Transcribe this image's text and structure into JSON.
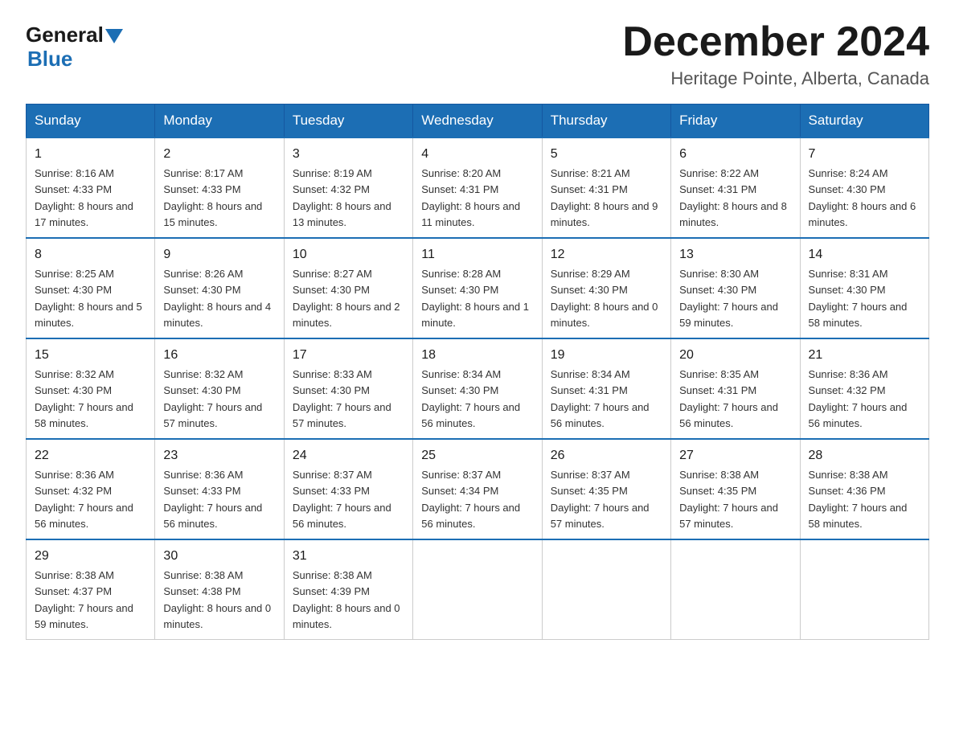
{
  "logo": {
    "general": "General",
    "blue": "Blue"
  },
  "title": "December 2024",
  "subtitle": "Heritage Pointe, Alberta, Canada",
  "days_of_week": [
    "Sunday",
    "Monday",
    "Tuesday",
    "Wednesday",
    "Thursday",
    "Friday",
    "Saturday"
  ],
  "weeks": [
    [
      {
        "num": "1",
        "sunrise": "8:16 AM",
        "sunset": "4:33 PM",
        "daylight": "8 hours and 17 minutes."
      },
      {
        "num": "2",
        "sunrise": "8:17 AM",
        "sunset": "4:33 PM",
        "daylight": "8 hours and 15 minutes."
      },
      {
        "num": "3",
        "sunrise": "8:19 AM",
        "sunset": "4:32 PM",
        "daylight": "8 hours and 13 minutes."
      },
      {
        "num": "4",
        "sunrise": "8:20 AM",
        "sunset": "4:31 PM",
        "daylight": "8 hours and 11 minutes."
      },
      {
        "num": "5",
        "sunrise": "8:21 AM",
        "sunset": "4:31 PM",
        "daylight": "8 hours and 9 minutes."
      },
      {
        "num": "6",
        "sunrise": "8:22 AM",
        "sunset": "4:31 PM",
        "daylight": "8 hours and 8 minutes."
      },
      {
        "num": "7",
        "sunrise": "8:24 AM",
        "sunset": "4:30 PM",
        "daylight": "8 hours and 6 minutes."
      }
    ],
    [
      {
        "num": "8",
        "sunrise": "8:25 AM",
        "sunset": "4:30 PM",
        "daylight": "8 hours and 5 minutes."
      },
      {
        "num": "9",
        "sunrise": "8:26 AM",
        "sunset": "4:30 PM",
        "daylight": "8 hours and 4 minutes."
      },
      {
        "num": "10",
        "sunrise": "8:27 AM",
        "sunset": "4:30 PM",
        "daylight": "8 hours and 2 minutes."
      },
      {
        "num": "11",
        "sunrise": "8:28 AM",
        "sunset": "4:30 PM",
        "daylight": "8 hours and 1 minute."
      },
      {
        "num": "12",
        "sunrise": "8:29 AM",
        "sunset": "4:30 PM",
        "daylight": "8 hours and 0 minutes."
      },
      {
        "num": "13",
        "sunrise": "8:30 AM",
        "sunset": "4:30 PM",
        "daylight": "7 hours and 59 minutes."
      },
      {
        "num": "14",
        "sunrise": "8:31 AM",
        "sunset": "4:30 PM",
        "daylight": "7 hours and 58 minutes."
      }
    ],
    [
      {
        "num": "15",
        "sunrise": "8:32 AM",
        "sunset": "4:30 PM",
        "daylight": "7 hours and 58 minutes."
      },
      {
        "num": "16",
        "sunrise": "8:32 AM",
        "sunset": "4:30 PM",
        "daylight": "7 hours and 57 minutes."
      },
      {
        "num": "17",
        "sunrise": "8:33 AM",
        "sunset": "4:30 PM",
        "daylight": "7 hours and 57 minutes."
      },
      {
        "num": "18",
        "sunrise": "8:34 AM",
        "sunset": "4:30 PM",
        "daylight": "7 hours and 56 minutes."
      },
      {
        "num": "19",
        "sunrise": "8:34 AM",
        "sunset": "4:31 PM",
        "daylight": "7 hours and 56 minutes."
      },
      {
        "num": "20",
        "sunrise": "8:35 AM",
        "sunset": "4:31 PM",
        "daylight": "7 hours and 56 minutes."
      },
      {
        "num": "21",
        "sunrise": "8:36 AM",
        "sunset": "4:32 PM",
        "daylight": "7 hours and 56 minutes."
      }
    ],
    [
      {
        "num": "22",
        "sunrise": "8:36 AM",
        "sunset": "4:32 PM",
        "daylight": "7 hours and 56 minutes."
      },
      {
        "num": "23",
        "sunrise": "8:36 AM",
        "sunset": "4:33 PM",
        "daylight": "7 hours and 56 minutes."
      },
      {
        "num": "24",
        "sunrise": "8:37 AM",
        "sunset": "4:33 PM",
        "daylight": "7 hours and 56 minutes."
      },
      {
        "num": "25",
        "sunrise": "8:37 AM",
        "sunset": "4:34 PM",
        "daylight": "7 hours and 56 minutes."
      },
      {
        "num": "26",
        "sunrise": "8:37 AM",
        "sunset": "4:35 PM",
        "daylight": "7 hours and 57 minutes."
      },
      {
        "num": "27",
        "sunrise": "8:38 AM",
        "sunset": "4:35 PM",
        "daylight": "7 hours and 57 minutes."
      },
      {
        "num": "28",
        "sunrise": "8:38 AM",
        "sunset": "4:36 PM",
        "daylight": "7 hours and 58 minutes."
      }
    ],
    [
      {
        "num": "29",
        "sunrise": "8:38 AM",
        "sunset": "4:37 PM",
        "daylight": "7 hours and 59 minutes."
      },
      {
        "num": "30",
        "sunrise": "8:38 AM",
        "sunset": "4:38 PM",
        "daylight": "8 hours and 0 minutes."
      },
      {
        "num": "31",
        "sunrise": "8:38 AM",
        "sunset": "4:39 PM",
        "daylight": "8 hours and 0 minutes."
      },
      null,
      null,
      null,
      null
    ]
  ],
  "labels": {
    "sunrise": "Sunrise:",
    "sunset": "Sunset:",
    "daylight": "Daylight:"
  }
}
